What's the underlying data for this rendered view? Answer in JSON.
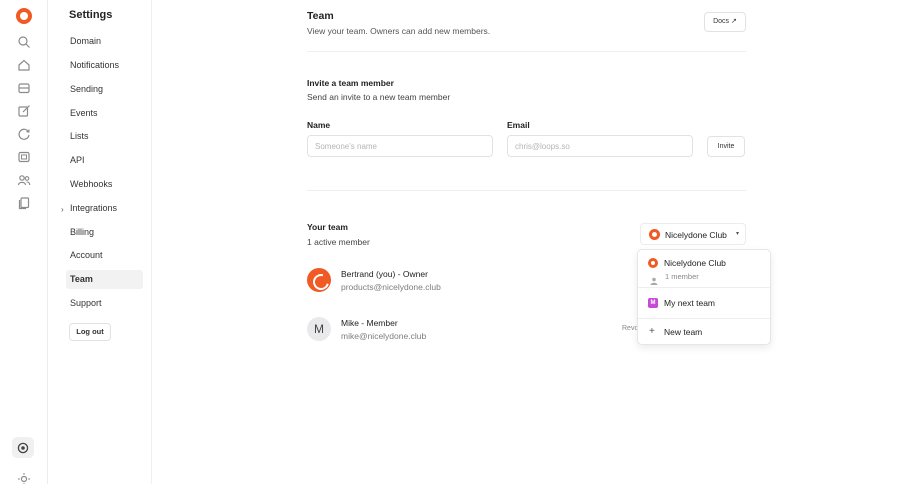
{
  "settings": {
    "title": "Settings",
    "nav": [
      {
        "label": "Domain"
      },
      {
        "label": "Notifications"
      },
      {
        "label": "Sending"
      },
      {
        "label": "Events"
      },
      {
        "label": "Lists"
      },
      {
        "label": "API"
      },
      {
        "label": "Webhooks"
      },
      {
        "label": "Integrations"
      },
      {
        "label": "Billing"
      },
      {
        "label": "Account"
      },
      {
        "label": "Team"
      },
      {
        "label": "Support"
      }
    ],
    "active": "Team",
    "logout_label": "Log out"
  },
  "rail": {
    "icons": [
      "logo-icon",
      "search-icon",
      "home-icon",
      "inbox-icon",
      "edit-icon",
      "refresh-icon",
      "media-icon",
      "users-icon",
      "docs-icon",
      "settings-icon",
      "sun-icon"
    ]
  },
  "header": {
    "title": "Team",
    "subtitle": "View your team. Owners can add new members.",
    "docs_label": "Docs ↗"
  },
  "invite": {
    "title": "Invite a team member",
    "subtitle": "Send an invite to a new team member",
    "name_label": "Name",
    "name_placeholder": "Someone's name",
    "email_label": "Email",
    "email_placeholder": "chris@loops.so",
    "button_label": "Invite"
  },
  "team": {
    "title": "Your team",
    "subtitle": "1 active member",
    "selected_team": "Nicelydone Club",
    "members": [
      {
        "name": "Bertrand (you) - Owner",
        "email": "products@nicelydone.club"
      },
      {
        "name": "Mike - Member",
        "email": "mike@nicelydone.club",
        "avatar_letter": "M",
        "action": "Revo"
      }
    ]
  },
  "dropdown": {
    "current_team": "Nicelydone Club",
    "current_members": "1 member",
    "other_team": "My next team",
    "other_team_initial": "M",
    "new_team_label": "New team"
  },
  "colors": {
    "brand": "#f05a24",
    "team_badge": "#c64ad7"
  }
}
